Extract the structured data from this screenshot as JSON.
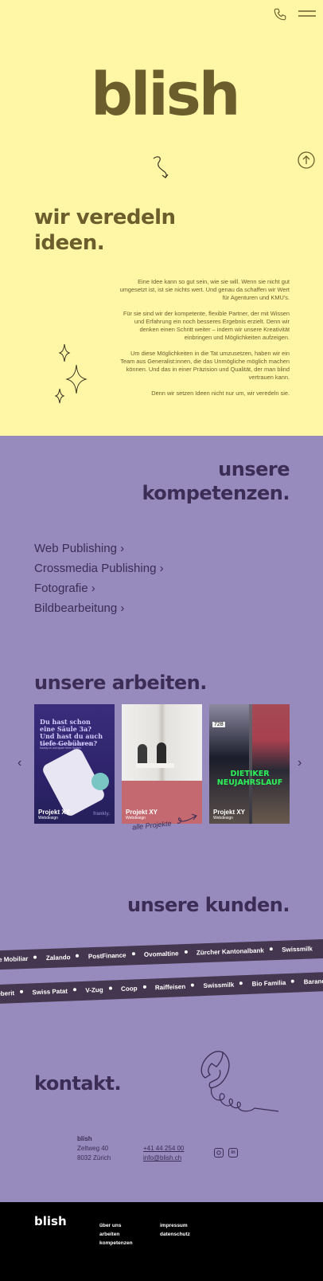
{
  "header": {
    "phone_icon": "phone-icon",
    "menu_icon": "hamburger-menu-icon"
  },
  "hero": {
    "logo": "blish",
    "tagline_line1": "wir veredeln",
    "tagline_line2": "ideen.",
    "intro_paragraphs": [
      "Eine Idee kann so gut sein, wie sie will. Wenn sie nicht gut umgesetzt ist, ist sie nichts wert. Und genau da schaffen wir Wert für Agenturen und KMU's.",
      "Für sie sind wir der kompetente, flexible Partner, der mit Wissen und Erfahrung ein noch besseres Ergebnis erzielt. Denn wir denken einen Schritt weiter – indem wir unsere Kreativität einbringen und Möglichkeiten aufzeigen.",
      "Um diese Möglichkeiten in die Tat umzusetzen, haben wir ein Team aus Generalist:innen, die das Unmögliche möglich machen können. Und das in einer Präzision und Qualität, der man blind vertrauen kann.",
      "Denn wir setzen Ideen nicht nur um, wir veredeln sie."
    ]
  },
  "kompetenzen": {
    "title_line1": "unsere",
    "title_line2": "kompetenzen.",
    "items": [
      {
        "label": "Web Publishing ›"
      },
      {
        "label": "Crossmedia Publishing ›"
      },
      {
        "label": "Fotografie ›"
      },
      {
        "label": "Bildbearbeitung ›"
      }
    ]
  },
  "arbeiten": {
    "title": "unsere arbeiten.",
    "prev": "‹",
    "next": "›",
    "cards": [
      {
        "title": "Projekt XY",
        "subtitle": "Webdesign",
        "headline": "Du hast schon eine Säule 3a? Und hast du auch tiefe Gebühren?",
        "body": "Teste jetzt, unseren Vergleichsrechner auf frankly.ch und spare beim Sparen.",
        "brand": "frankly."
      },
      {
        "title": "Projekt XY",
        "subtitle": "Webdesign"
      },
      {
        "title": "Projekt XY",
        "subtitle": "Webdesign",
        "bib": "728",
        "event_line1": "DIETIKER",
        "event_line2": "NEUJAHRSLAUF"
      }
    ],
    "all_projects": "alle Projekte"
  },
  "kunden": {
    "title": "unsere kunden.",
    "row1": [
      "Die Mobiliar",
      "Zalando",
      "PostFinance",
      "Ovomaltine",
      "Zürcher Kantonalbank",
      "Swissmilk"
    ],
    "row2": [
      "Geberit",
      "Swiss Patat",
      "V-Zug",
      "Coop",
      "Raiffeisen",
      "Swissmilk",
      "Bio Familia",
      "Barandun"
    ]
  },
  "kontakt": {
    "title": "kontakt.",
    "company": "blish",
    "street": "Zeltweg 40",
    "city": "8032 Zürich",
    "phone": "+41 44 254 00",
    "email": "info@blish.ch",
    "instagram_icon": "instagram-icon",
    "linkedin_icon": "linkedin-icon"
  },
  "footer": {
    "logo": "blish",
    "col1": [
      "über uns",
      "arbeiten",
      "kompetenzen"
    ],
    "col2": [
      "impressum",
      "datenschutz"
    ]
  },
  "colors": {
    "hero_bg": "#fff6a6",
    "hero_text": "#6b5e2c",
    "purple_bg": "#978bbd",
    "purple_text": "#3b2d55",
    "band_bg": "#45364f",
    "footer_bg": "#000000"
  }
}
